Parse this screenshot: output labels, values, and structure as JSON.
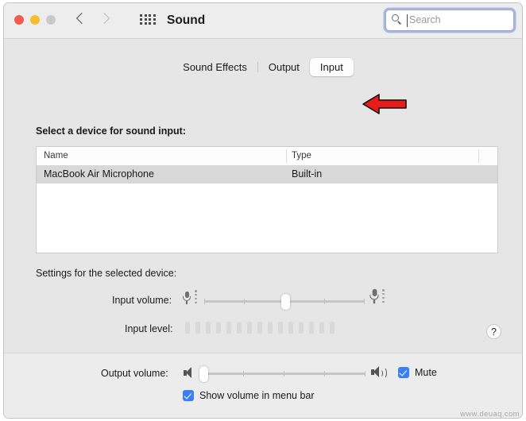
{
  "window": {
    "title": "Sound",
    "traffic_lights": [
      "close-button",
      "minimize-button",
      "maximize-button"
    ],
    "nav": {
      "back": "back-chevron",
      "forward": "forward-chevron"
    },
    "grid_icon": "show-all-preferences-icon"
  },
  "search": {
    "placeholder": "Search",
    "value": "",
    "icon": "search-icon"
  },
  "tabs": [
    {
      "label": "Sound Effects",
      "active": false
    },
    {
      "label": "Output",
      "active": false
    },
    {
      "label": "Input",
      "active": true
    }
  ],
  "annotation": {
    "type": "red-arrow",
    "points_to": "Input"
  },
  "input_pane": {
    "device_list_label": "Select a device for sound input:",
    "columns": [
      "Name",
      "Type"
    ],
    "rows": [
      {
        "name": "MacBook Air Microphone",
        "type": "Built-in",
        "selected": true
      }
    ],
    "settings_label": "Settings for the selected device:",
    "input_volume_label": "Input volume:",
    "input_volume_percent": 50,
    "input_level_label": "Input level:",
    "input_level_segments": 15,
    "input_level_active": 0,
    "help_label": "?"
  },
  "footer": {
    "output_volume_label": "Output volume:",
    "output_volume_percent": 2,
    "mute_label": "Mute",
    "mute_checked": true,
    "menubar_label": "Show volume in menu bar",
    "menubar_checked": true
  },
  "watermark": "www.deuaq.com",
  "colors": {
    "accent": "#3b7ff5",
    "close": "#f05b4f",
    "minimize": "#f7bd2e",
    "maximize": "#c9c9c9",
    "arrow": "#e81b18"
  }
}
